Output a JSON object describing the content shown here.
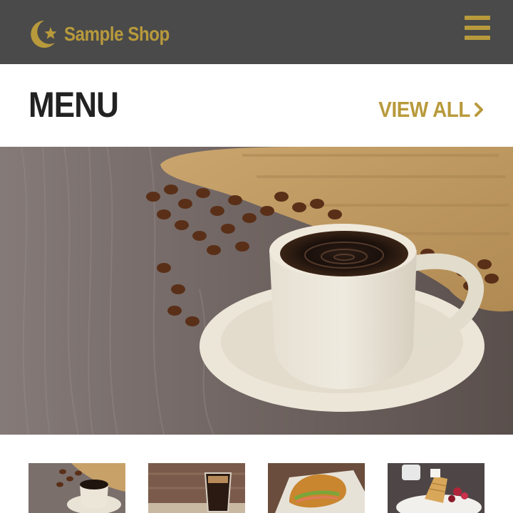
{
  "header": {
    "logo_text": "Sample Shop",
    "logo_icon": "moon-star-logo",
    "menu_icon": "hamburger-menu-icon",
    "brand_color": "#b89a3c",
    "background_color": "#4a4a4a"
  },
  "section": {
    "title": "MENU",
    "view_all_label": "VIEW ALL",
    "view_all_icon": "chevron-right-icon"
  },
  "hero": {
    "subject": "coffee-cup-with-beans-photo"
  },
  "thumbnails": [
    {
      "subject": "coffee-cup-photo"
    },
    {
      "subject": "iced-coffee-photo"
    },
    {
      "subject": "croissant-sandwich-photo"
    },
    {
      "subject": "waffle-dessert-photo"
    }
  ]
}
